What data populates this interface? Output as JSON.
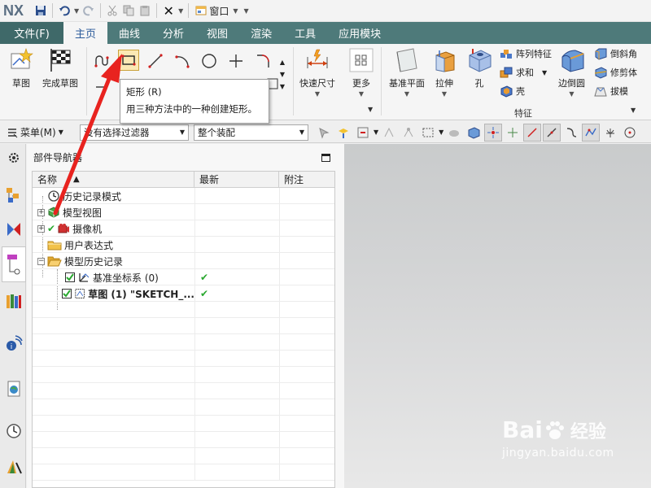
{
  "app": {
    "logo": "NX"
  },
  "window_menu": {
    "label": "窗口"
  },
  "tabs": {
    "file": "文件(F)",
    "items": [
      "主页",
      "曲线",
      "分析",
      "视图",
      "渲染",
      "工具",
      "应用模块"
    ],
    "active_index": 0
  },
  "ribbon": {
    "sketch_label": "草图",
    "finish_sketch_label": "完成草图",
    "quick_dimension_label": "快速尺寸",
    "more_label": "更多",
    "datum_plane_label": "基准平面",
    "extrude_label": "拉伸",
    "hole_label": "孔",
    "pattern_feature_label": "阵列特征",
    "unite_label": "求和",
    "shell_label": "壳",
    "edge_blend_label": "边倒圆",
    "chamfer_label": "倒斜角",
    "trim_body_label": "修剪体",
    "draft_label": "拔模",
    "feature_group_label": "特征"
  },
  "tooltip": {
    "title": "矩形 (R)",
    "body": "用三种方法中的一种创建矩形。"
  },
  "toolbar2": {
    "menu_label": "菜单(M)",
    "filter_value": "没有选择过滤器",
    "assembly_value": "整个装配"
  },
  "navigator": {
    "title": "部件导航器",
    "columns": [
      "名称",
      "最新",
      "附注"
    ],
    "rows": [
      {
        "label": "历史记录模式",
        "bold": false
      },
      {
        "label": "模型视图",
        "bold": false
      },
      {
        "label": "摄像机",
        "bold": false
      },
      {
        "label": "用户表达式",
        "bold": false
      },
      {
        "label": "模型历史记录",
        "bold": false
      },
      {
        "label": "基准坐标系 (0)",
        "bold": false,
        "latest": "✔"
      },
      {
        "label": "草图 (1) \"SKETCH_...",
        "bold": true,
        "latest": "✔"
      }
    ]
  },
  "watermark": {
    "main_text": "Bai",
    "main_text_2": "经验",
    "sub_text": "jingyan.baidu.com"
  },
  "colors": {
    "tab_bar": "#4e7a7a",
    "file_tab": "#3f6969",
    "active_tab_text": "#2a5a9a",
    "arrow": "#e8231f",
    "check": "#2aa830"
  }
}
